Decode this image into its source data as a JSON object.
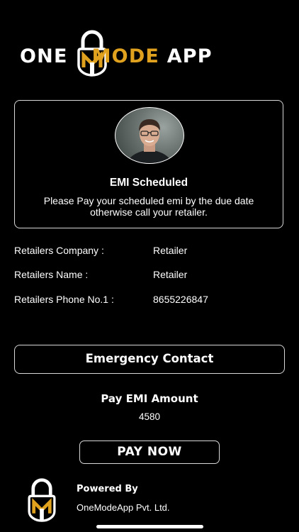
{
  "brand": {
    "logo_parts": [
      "ONE",
      "MODE",
      "APP"
    ],
    "accent_color": "#E0A21E"
  },
  "card": {
    "title": "EMI Scheduled",
    "message": "Please Pay your scheduled emi by the due date otherwise call your retailer."
  },
  "retailer": {
    "rows": [
      {
        "label": "Retailers Company :",
        "value": "Retailer"
      },
      {
        "label": "Retailers Name :",
        "value": "Retailer"
      },
      {
        "label": "Retailers Phone No.1 :",
        "value": "8655226847"
      }
    ]
  },
  "emergency_button": {
    "label": "Emergency Contact"
  },
  "pay": {
    "title": "Pay EMI Amount",
    "amount": "4580",
    "button_label": "PAY NOW"
  },
  "footer": {
    "powered_by": "Powered By",
    "company": "OneModeApp Pvt. Ltd."
  },
  "icons": {
    "logo": "padlock-logo-icon",
    "avatar": "user-avatar-photo",
    "footer_logo": "padlock-logo-icon"
  }
}
